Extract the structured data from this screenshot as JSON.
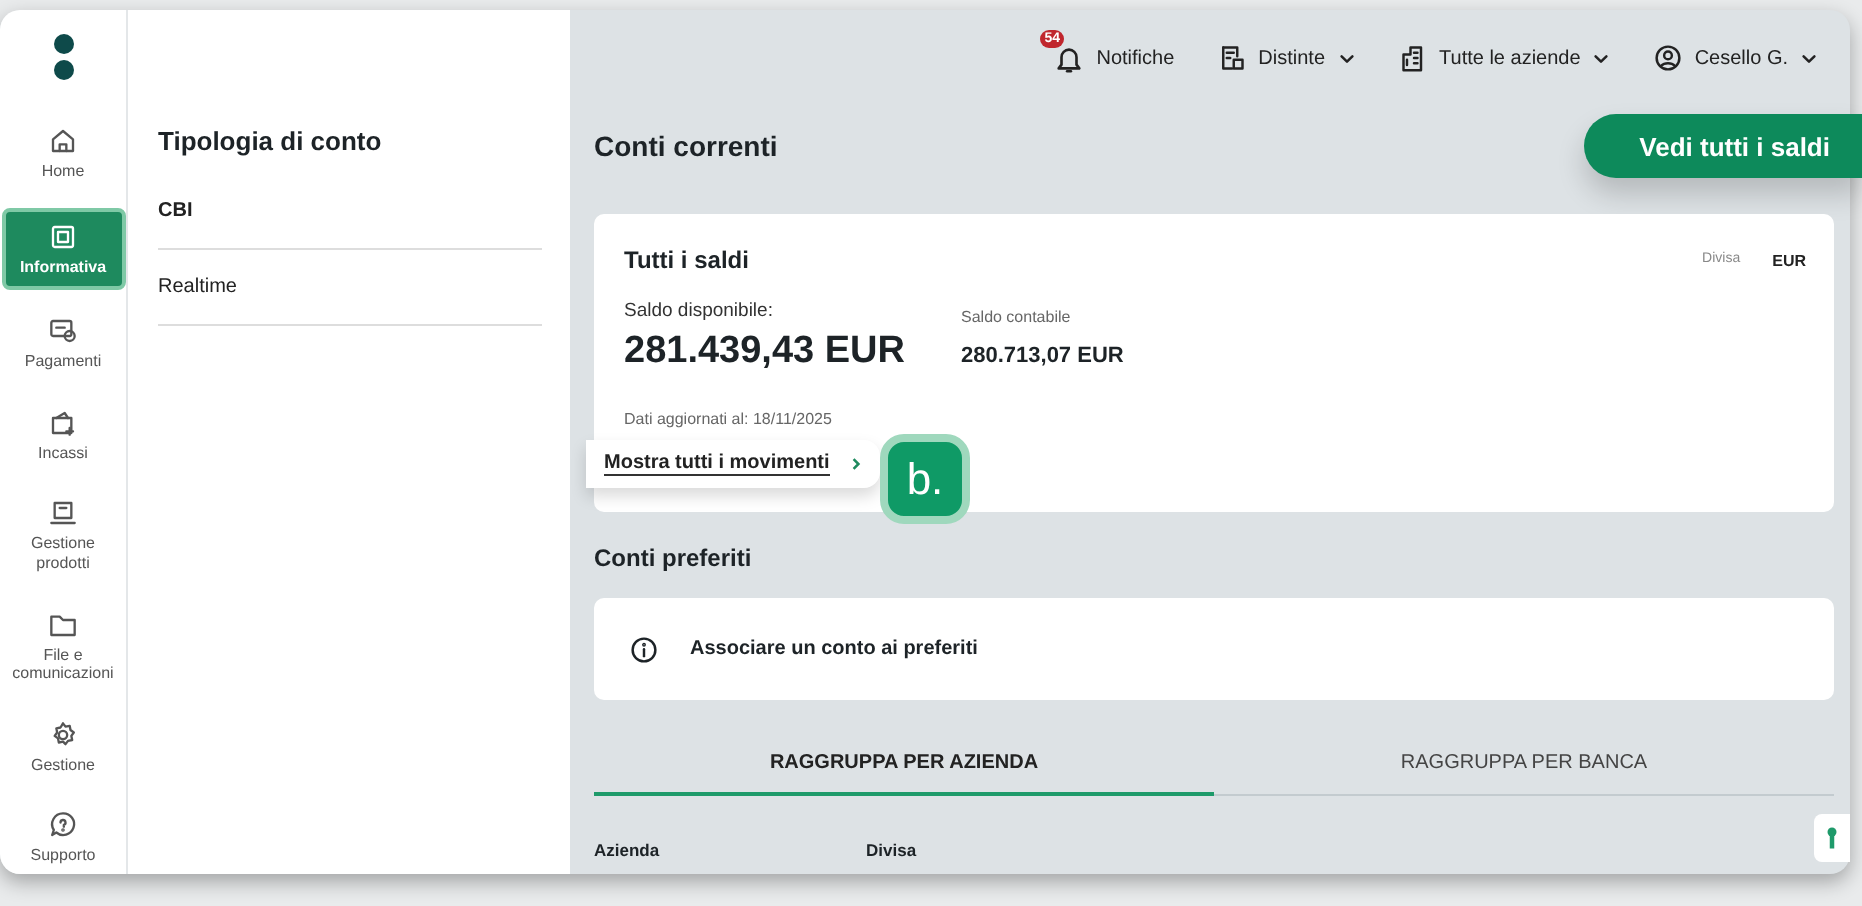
{
  "nav": {
    "items": [
      {
        "label": "Home",
        "selected": false
      },
      {
        "label": "Informativa",
        "selected": true
      },
      {
        "label": "Pagamenti",
        "selected": false
      },
      {
        "label": "Incassi",
        "selected": false
      },
      {
        "label": "Gestione prodotti",
        "selected": false
      },
      {
        "label": "File e comunicazioni",
        "selected": false
      },
      {
        "label": "Gestione",
        "selected": false
      },
      {
        "label": "Supporto",
        "selected": false
      }
    ]
  },
  "subpanel": {
    "title": "Tipologia di conto",
    "items": [
      {
        "label": "CBI",
        "selected": true
      },
      {
        "label": "Realtime",
        "selected": false
      }
    ]
  },
  "topbar": {
    "notifications": {
      "count": "54",
      "label": "Notifiche"
    },
    "menus": [
      {
        "label": "Distinte"
      },
      {
        "label": "Tutte le aziende"
      },
      {
        "label": "Cesello G."
      }
    ]
  },
  "page": {
    "title": "Conti correnti",
    "action": "Vedi tutti i saldi"
  },
  "balances": {
    "title": "Tutti i saldi",
    "currency_label": "Divisa",
    "currency": "EUR",
    "available_label": "Saldo disponibile:",
    "available": "281.439,43 EUR",
    "accounting_label": "Saldo contabile",
    "accounting": "280.713,07 EUR",
    "updated": "Dati aggiornati al: 18/11/2025",
    "link": "Mostra tutti i movimenti",
    "callout": "b."
  },
  "favorites": {
    "title": "Conti preferiti",
    "message": "Associare un conto ai preferiti"
  },
  "tabs": [
    {
      "label": "RAGGRUPPA PER AZIENDA",
      "selected": true
    },
    {
      "label": "RAGGRUPPA PER BANCA",
      "selected": false
    }
  ],
  "table": {
    "columns": [
      "Azienda",
      "Divisa"
    ]
  }
}
